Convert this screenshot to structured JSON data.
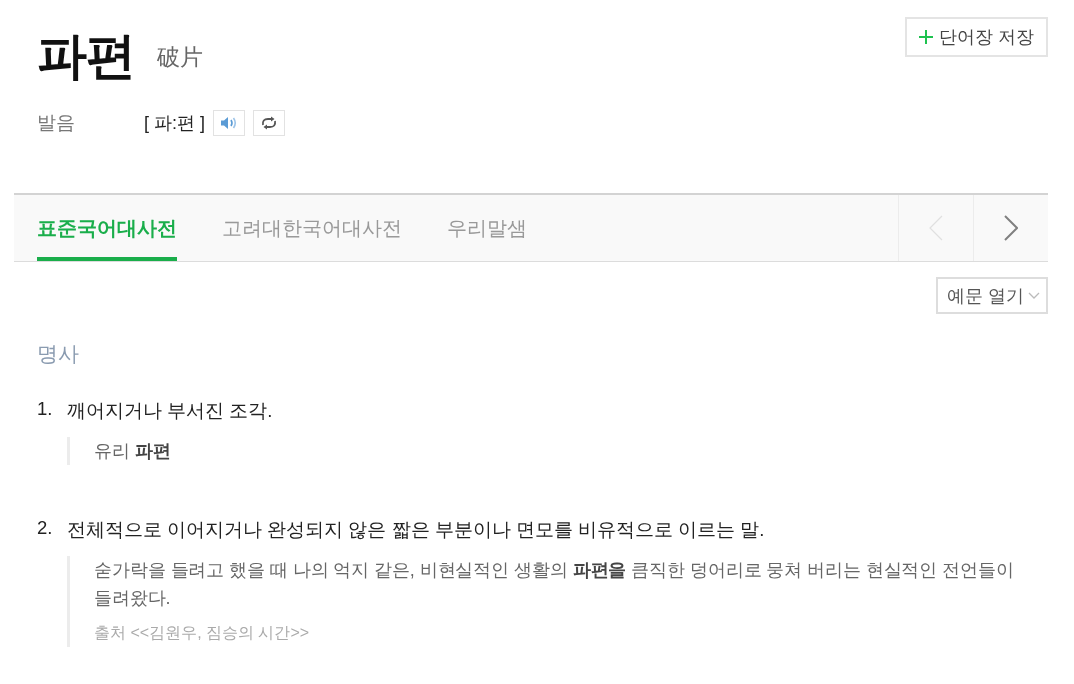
{
  "entry": {
    "headword": "파편",
    "hanja": "破片"
  },
  "save_button": {
    "label": "단어장 저장"
  },
  "pronunciation": {
    "label": "발음",
    "value": "[ 파:편 ]"
  },
  "tabs": [
    {
      "label": "표준국어대사전",
      "selected": true
    },
    {
      "label": "고려대한국어대사전",
      "selected": false
    },
    {
      "label": "우리말샘",
      "selected": false
    }
  ],
  "tab_nav": [
    {
      "kind": "prev",
      "disabled": true
    },
    {
      "kind": "next",
      "disabled": false
    }
  ],
  "example_toggle": {
    "label": "예문 열기"
  },
  "part_of_speech": "명사",
  "senses": [
    {
      "number": "1.",
      "definition": "깨어지거나 부서진 조각.",
      "examples": [
        {
          "text": "유리 **파편**"
        }
      ]
    },
    {
      "number": "2.",
      "definition": "전체적으로 이어지거나 완성되지 않은 짧은 부분이나 면모를 비유적으로 이르는 말.",
      "examples": [
        {
          "text": "숟가락을 들려고 했을 때 나의 억지 같은, 비현실적인 생활의 **파편을** 큼직한 덩어리로 뭉쳐 버리는 현실적인 전언들이 들려왔다.",
          "source": "출처 <<김원우, 짐승의 시간>>"
        }
      ]
    }
  ]
}
